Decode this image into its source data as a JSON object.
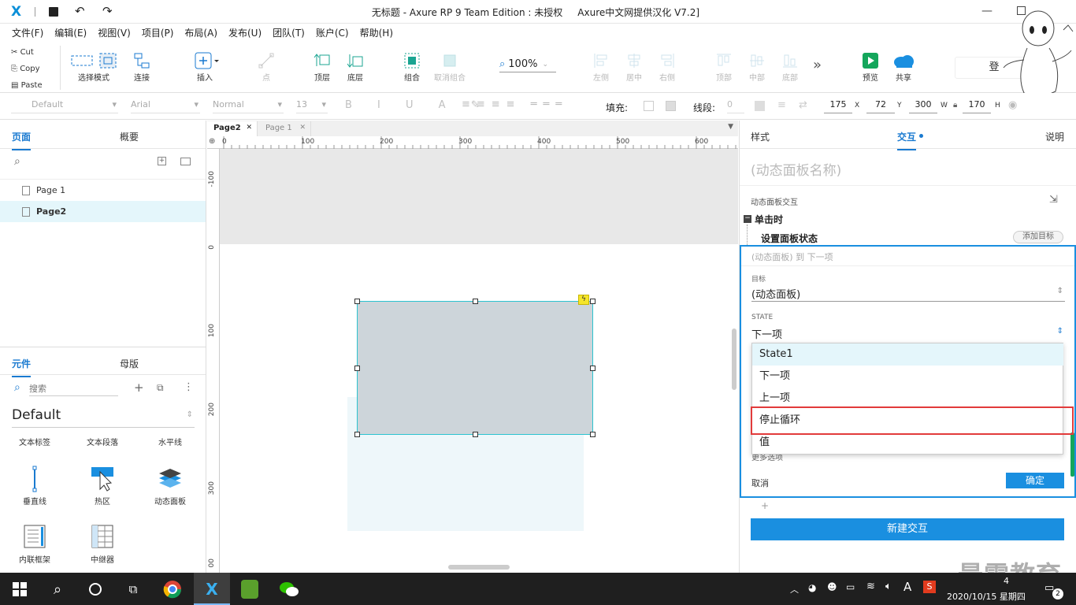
{
  "window": {
    "title": "无标题 - Axure RP 9 Team Edition : 未授权     Axure中文网提供汉化 V7.2]"
  },
  "menu": [
    "文件(F)",
    "编辑(E)",
    "视图(V)",
    "项目(P)",
    "布局(A)",
    "发布(U)",
    "团队(T)",
    "账户(C)",
    "帮助(H)"
  ],
  "clipboard": {
    "cut": "Cut",
    "copy": "Copy",
    "paste": "Paste"
  },
  "toolbar": {
    "select_mode": "选择模式",
    "connect": "连接",
    "insert": "插入",
    "point": "点",
    "top_layer": "顶层",
    "bottom_layer": "底层",
    "group": "组合",
    "ungroup": "取消组合",
    "zoom": "100%",
    "align_left": "左侧",
    "align_center": "居中",
    "align_right": "右侧",
    "align_top": "顶部",
    "align_middle": "中部",
    "align_bottom": "底部",
    "more": "»",
    "preview": "预览",
    "share": "共享",
    "login": "登"
  },
  "format": {
    "style": "Default",
    "font": "Arial",
    "weight": "Normal",
    "size": "13",
    "fill_label": "填充:",
    "stroke_label": "线段:",
    "stroke_value": "0",
    "x": "175",
    "x_label": "X",
    "y": "72",
    "y_label": "Y",
    "w": "300",
    "w_label": "W",
    "h": "170",
    "h_label": "H"
  },
  "left": {
    "tab_pages": "页面",
    "tab_outline": "概要",
    "pages": [
      "Page 1",
      "Page2"
    ],
    "tab_widgets": "元件",
    "tab_masters": "母版",
    "search_placeholder": "搜索",
    "library": "Default",
    "widgets": [
      "文本标签",
      "文本段落",
      "水平线",
      "垂直线",
      "热区",
      "动态面板",
      "内联框架",
      "中继器"
    ]
  },
  "canvas": {
    "tabs": [
      "Page2",
      "Page 1"
    ],
    "ruler_h": [
      "0",
      "100",
      "200",
      "300",
      "400",
      "500",
      "600"
    ],
    "ruler_v": [
      "-100",
      "0",
      "100",
      "200",
      "300",
      "00"
    ]
  },
  "right": {
    "tab_style": "样式",
    "tab_interact": "交互",
    "tab_notes": "说明",
    "panel_name_placeholder": "(动态面板名称)",
    "section_label": "动态面板交互",
    "event": "单击时",
    "action": "设置面板状态",
    "add_target": "添加目标",
    "summary": "(动态面板) 到 下一项",
    "target_label": "目标",
    "target_value": "(动态面板)",
    "state_label": "STATE",
    "state_value": "下一项",
    "options": [
      "State1",
      "下一项",
      "上一项",
      "停止循环",
      "值"
    ],
    "more_options": "更多选项",
    "cancel": "取消",
    "confirm": "确定",
    "new_interaction": "新建交互",
    "plus": "+"
  },
  "watermark": "最需教育",
  "taskbar": {
    "time": "4",
    "date": "2020/10/15 星期四",
    "notif": "2"
  }
}
